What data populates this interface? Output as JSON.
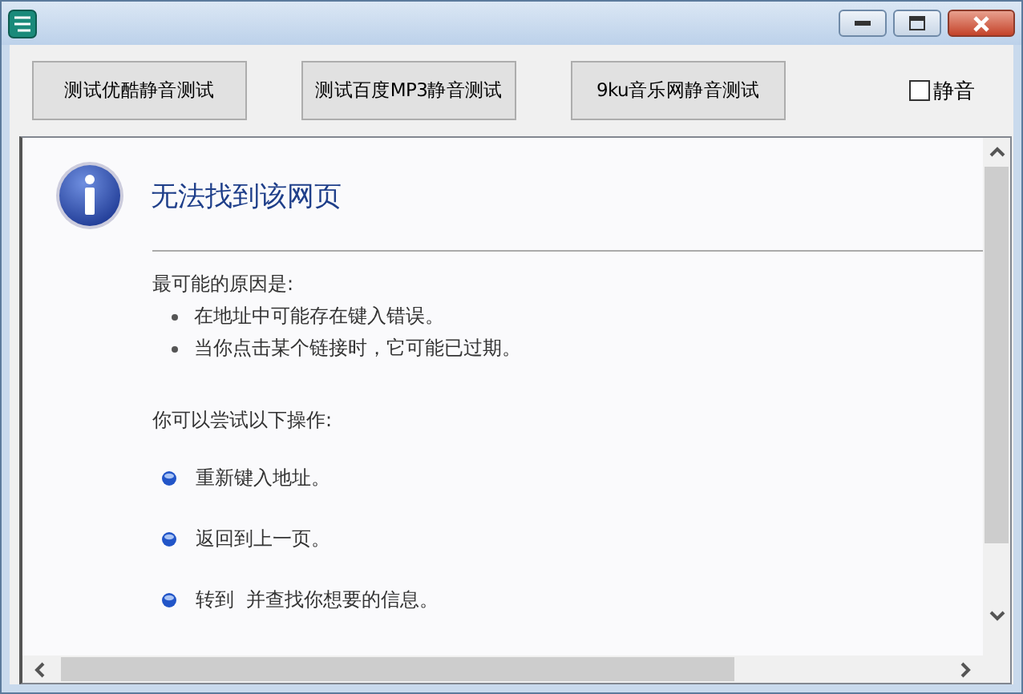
{
  "toolbar": {
    "buttons": [
      "测试优酷静音测试",
      "测试百度MP3静音测试",
      "9ku音乐网静音测试"
    ],
    "mute": {
      "label": "静音",
      "checked": false
    }
  },
  "page": {
    "title": "无法找到该网页",
    "causes_heading": "最可能的原因是:",
    "causes": [
      "在地址中可能存在键入错误。",
      "当你点击某个链接时，它可能已过期。"
    ],
    "actions_heading": "你可以尝试以下操作:",
    "actions": [
      "重新键入地址。",
      "返回到上一页。",
      "转到  并查找你想要的信息。"
    ]
  }
}
